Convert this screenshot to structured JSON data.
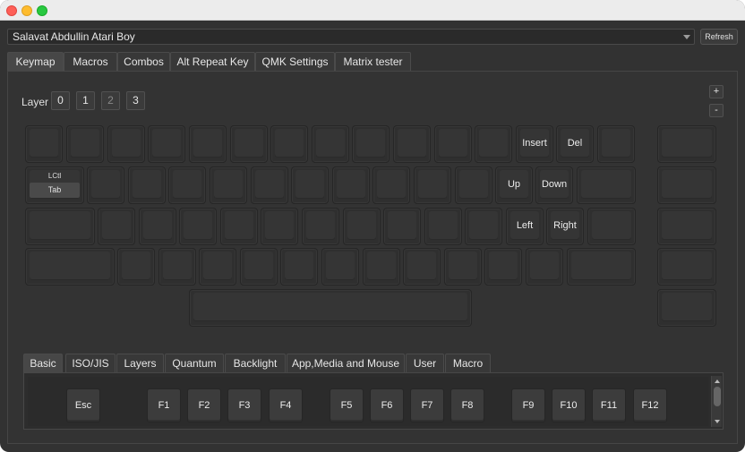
{
  "device_selector": {
    "value": "Salavat Abdullin Atari Boy"
  },
  "refresh_label": "Refresh",
  "main_tabs": [
    "Keymap",
    "Macros",
    "Combos",
    "Alt Repeat Key",
    "QMK Settings",
    "Matrix tester"
  ],
  "active_main_tab": "Keymap",
  "layer": {
    "label": "Layer",
    "buttons": [
      "0",
      "1",
      "2",
      "3"
    ],
    "selected": "2"
  },
  "zoom": {
    "plus": "+",
    "minus": "-"
  },
  "keyboard_keys": {
    "insert": "Insert",
    "del": "Del",
    "tab_modifier": "LCtl",
    "tab": "Tab",
    "up": "Up",
    "down": "Down",
    "left": "Left",
    "right": "Right"
  },
  "bottom_tabs": [
    "Basic",
    "ISO/JIS",
    "Layers",
    "Quantum",
    "Backlight",
    "App,Media and Mouse",
    "User",
    "Macro"
  ],
  "active_bottom_tab": "Basic",
  "palette_keys": [
    "Esc",
    "F1",
    "F2",
    "F3",
    "F4",
    "F5",
    "F6",
    "F7",
    "F8",
    "F9",
    "F10",
    "F11",
    "F12"
  ],
  "colors": {
    "window_bg": "#323232",
    "key_face": "#353535",
    "titlebar": "#ececec",
    "close": "#fe5f57",
    "minimize": "#febc2e",
    "maximize": "#28c840"
  }
}
